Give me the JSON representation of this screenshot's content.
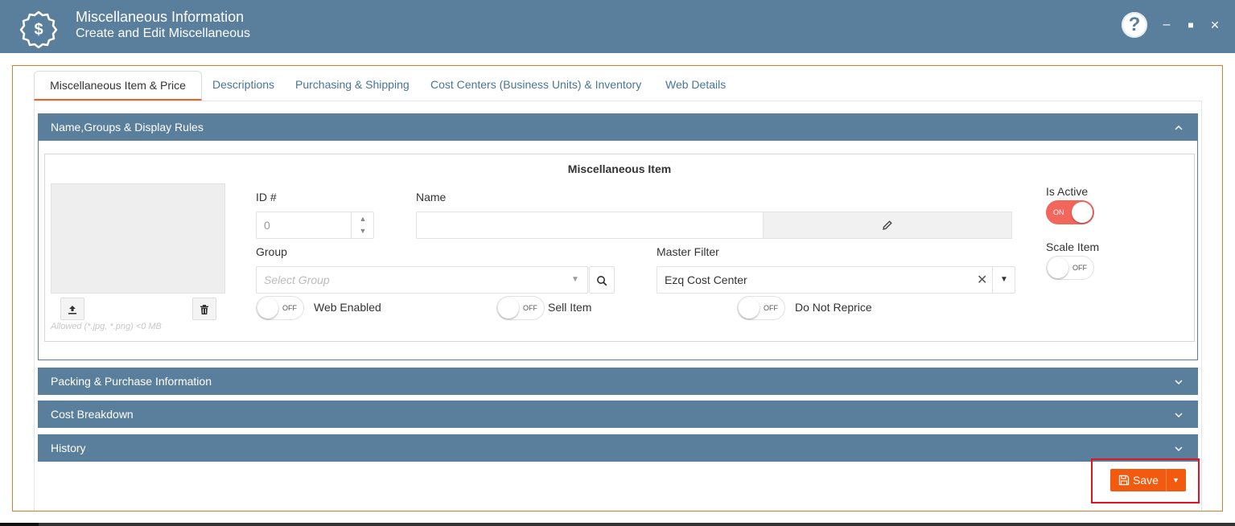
{
  "header": {
    "title": "Miscellaneous Information",
    "subtitle": "Create and Edit Miscellaneous",
    "help_glyph": "?",
    "minimize_glyph": "–",
    "maximize_glyph": "■",
    "close_glyph": "✕"
  },
  "tabs": [
    {
      "label": "Miscellaneous Item & Price"
    },
    {
      "label": "Descriptions"
    },
    {
      "label": "Purchasing & Shipping"
    },
    {
      "label": "Cost Centers (Business Units) & Inventory"
    },
    {
      "label": "Web Details"
    }
  ],
  "panels": {
    "name_groups": "Name,Groups & Display Rules",
    "packing": "Packing & Purchase Information",
    "cost_breakdown": "Cost Breakdown",
    "history": "History"
  },
  "form": {
    "section_title": "Miscellaneous Item",
    "allowed_note": "Allowed (*.jpg, *.png) <0 MB",
    "id_label": "ID #",
    "id_value": "0",
    "name_label": "Name",
    "name_value": "",
    "group_label": "Group",
    "group_placeholder": "Select Group",
    "master_filter_label": "Master Filter",
    "master_filter_value": "Ezq Cost Center",
    "is_active_label": "Is Active",
    "scale_item_label": "Scale Item",
    "web_enabled_label": "Web Enabled",
    "sell_item_label": "Sell Item",
    "do_not_reprice_label": "Do Not Reprice",
    "toggle_on": "ON",
    "toggle_off": "OFF"
  },
  "toggles": {
    "is_active": true,
    "scale_item": false,
    "web_enabled": false,
    "sell_item": false,
    "do_not_reprice": false
  },
  "footer": {
    "save_label": "Save"
  },
  "colors": {
    "header_bg": "#5a7f9c",
    "accent": "#f15a0f",
    "toggle_on": "#f2665c",
    "highlight_box": "#e0131f"
  },
  "icons": [
    "dollar-badge-icon",
    "help-icon",
    "minimize-icon",
    "maximize-icon",
    "close-icon",
    "pencil-icon",
    "search-icon",
    "upload-icon",
    "trash-icon",
    "chevron-up-icon",
    "chevron-down-icon",
    "spin-up-icon",
    "spin-down-icon",
    "clear-x-icon",
    "dropdown-caret-icon",
    "save-disk-icon"
  ]
}
